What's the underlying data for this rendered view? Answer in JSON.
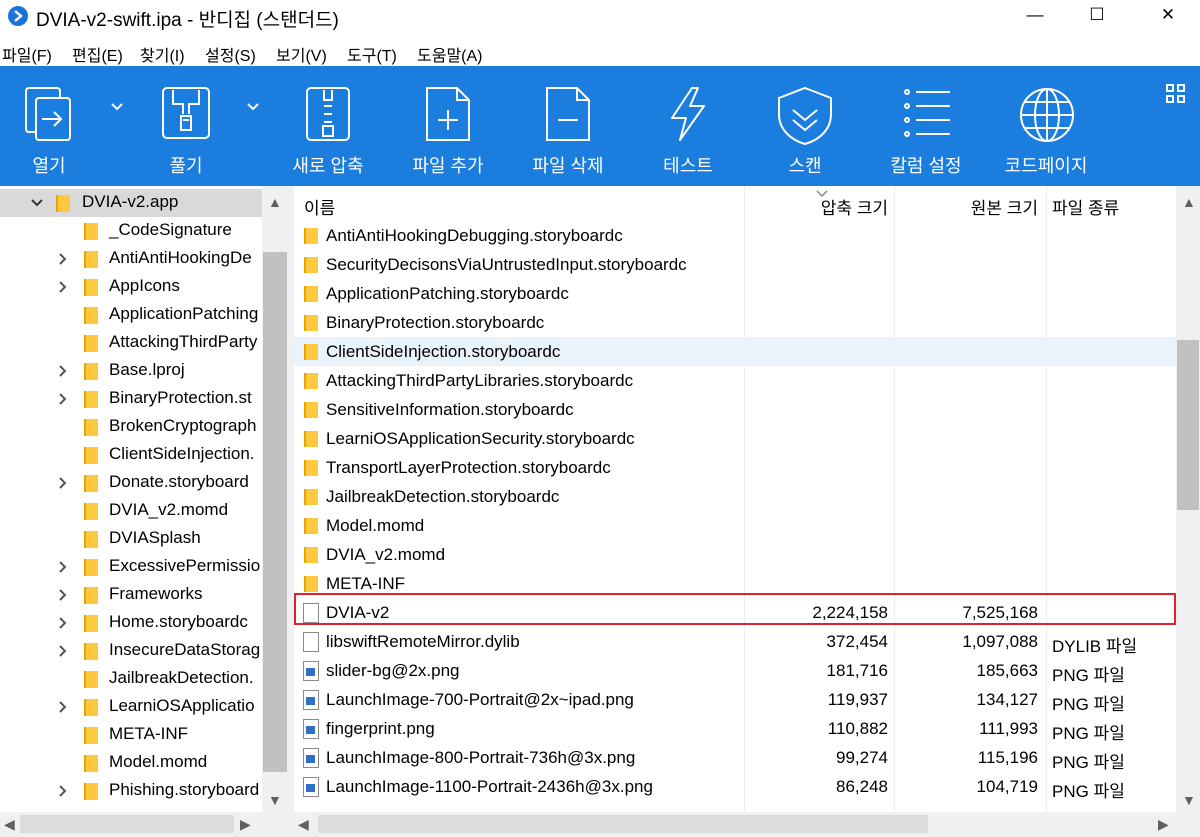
{
  "window": {
    "title": "DVIA-v2-swift.ipa - 반디집 (스탠더드)",
    "minimize_glyph": "—",
    "maximize_glyph": "☐",
    "close_glyph": "✕"
  },
  "menu": [
    "파일(F)",
    "편집(E)",
    "찾기(I)",
    "설정(S)",
    "보기(V)",
    "도구(T)",
    "도움말(A)"
  ],
  "toolbar": {
    "accent_color": "#1b7ddd",
    "buttons": [
      {
        "label": "열기",
        "icon": "open-icon"
      },
      {
        "label": "풀기",
        "icon": "extract-icon"
      },
      {
        "label": "새로 압축",
        "icon": "new-archive-icon"
      },
      {
        "label": "파일 추가",
        "icon": "add-file-icon"
      },
      {
        "label": "파일 삭제",
        "icon": "delete-file-icon"
      },
      {
        "label": "테스트",
        "icon": "test-icon"
      },
      {
        "label": "스캔",
        "icon": "scan-icon"
      },
      {
        "label": "칼럼 설정",
        "icon": "column-settings-icon"
      },
      {
        "label": "코드페이지",
        "icon": "codepage-icon"
      }
    ]
  },
  "tree": {
    "root": "DVIA-v2.app",
    "items": [
      {
        "label": "_CodeSignature",
        "expandable": false
      },
      {
        "label": "AntiAntiHookingDe",
        "expandable": true
      },
      {
        "label": "AppIcons",
        "expandable": true
      },
      {
        "label": "ApplicationPatching",
        "expandable": false
      },
      {
        "label": "AttackingThirdParty",
        "expandable": false
      },
      {
        "label": "Base.lproj",
        "expandable": true
      },
      {
        "label": "BinaryProtection.st",
        "expandable": true
      },
      {
        "label": "BrokenCryptograph",
        "expandable": false
      },
      {
        "label": "ClientSideInjection.",
        "expandable": false
      },
      {
        "label": "Donate.storyboard",
        "expandable": true
      },
      {
        "label": "DVIA_v2.momd",
        "expandable": false
      },
      {
        "label": "DVIASplash",
        "expandable": false
      },
      {
        "label": "ExcessivePermissio",
        "expandable": true
      },
      {
        "label": "Frameworks",
        "expandable": true
      },
      {
        "label": "Home.storyboardc",
        "expandable": true
      },
      {
        "label": "InsecureDataStorag",
        "expandable": true
      },
      {
        "label": "JailbreakDetection.",
        "expandable": false
      },
      {
        "label": "LearniOSApplicatio",
        "expandable": true
      },
      {
        "label": "META-INF",
        "expandable": false
      },
      {
        "label": "Model.momd",
        "expandable": false
      },
      {
        "label": "Phishing.storyboard",
        "expandable": true
      }
    ]
  },
  "columns": {
    "name": "이름",
    "packed": "압축 크기",
    "original": "원본 크기",
    "type": "파일 종류"
  },
  "files": [
    {
      "name": "AntiAntiHookingDebugging.storyboardc",
      "kind": "folder",
      "packed": "",
      "original": "",
      "type": ""
    },
    {
      "name": "SecurityDecisonsViaUntrustedInput.storyboardc",
      "kind": "folder",
      "packed": "",
      "original": "",
      "type": ""
    },
    {
      "name": "ApplicationPatching.storyboardc",
      "kind": "folder",
      "packed": "",
      "original": "",
      "type": ""
    },
    {
      "name": "BinaryProtection.storyboardc",
      "kind": "folder",
      "packed": "",
      "original": "",
      "type": ""
    },
    {
      "name": "ClientSideInjection.storyboardc",
      "kind": "folder",
      "packed": "",
      "original": "",
      "type": "",
      "highlighted": true
    },
    {
      "name": "AttackingThirdPartyLibraries.storyboardc",
      "kind": "folder",
      "packed": "",
      "original": "",
      "type": ""
    },
    {
      "name": "SensitiveInformation.storyboardc",
      "kind": "folder",
      "packed": "",
      "original": "",
      "type": ""
    },
    {
      "name": "LearniOSApplicationSecurity.storyboardc",
      "kind": "folder",
      "packed": "",
      "original": "",
      "type": ""
    },
    {
      "name": "TransportLayerProtection.storyboardc",
      "kind": "folder",
      "packed": "",
      "original": "",
      "type": ""
    },
    {
      "name": "JailbreakDetection.storyboardc",
      "kind": "folder",
      "packed": "",
      "original": "",
      "type": ""
    },
    {
      "name": "Model.momd",
      "kind": "folder",
      "packed": "",
      "original": "",
      "type": ""
    },
    {
      "name": "DVIA_v2.momd",
      "kind": "folder",
      "packed": "",
      "original": "",
      "type": ""
    },
    {
      "name": "META-INF",
      "kind": "folder",
      "packed": "",
      "original": "",
      "type": ""
    },
    {
      "name": "DVIA-v2",
      "kind": "file",
      "packed": "2,224,158",
      "original": "7,525,168",
      "type": "",
      "boxed": true
    },
    {
      "name": "libswiftRemoteMirror.dylib",
      "kind": "file",
      "packed": "372,454",
      "original": "1,097,088",
      "type": "DYLIB 파일"
    },
    {
      "name": "slider-bg@2x.png",
      "kind": "png",
      "packed": "181,716",
      "original": "185,663",
      "type": "PNG 파일"
    },
    {
      "name": "LaunchImage-700-Portrait@2x~ipad.png",
      "kind": "png",
      "packed": "119,937",
      "original": "134,127",
      "type": "PNG 파일"
    },
    {
      "name": "fingerprint.png",
      "kind": "png",
      "packed": "110,882",
      "original": "111,993",
      "type": "PNG 파일"
    },
    {
      "name": "LaunchImage-800-Portrait-736h@3x.png",
      "kind": "png",
      "packed": "99,274",
      "original": "115,196",
      "type": "PNG 파일"
    },
    {
      "name": "LaunchImage-1100-Portrait-2436h@3x.png",
      "kind": "png",
      "packed": "86,248",
      "original": "104,719",
      "type": "PNG 파일"
    }
  ]
}
